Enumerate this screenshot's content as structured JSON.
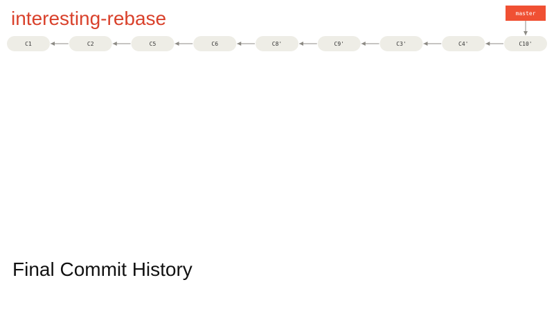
{
  "title": {
    "text": "interesting-rebase",
    "color": "#d9412b"
  },
  "caption": "Final Commit History",
  "colors": {
    "commit_fill": "#eeede6",
    "commit_text": "#333333",
    "arrow": "#8c8a84",
    "branch_fill": "#f05033",
    "branch_text": "#ffffff"
  },
  "commits": [
    {
      "label": "C1"
    },
    {
      "label": "C2"
    },
    {
      "label": "C5"
    },
    {
      "label": "C6"
    },
    {
      "label": "C8'"
    },
    {
      "label": "C9'"
    },
    {
      "label": "C3'"
    },
    {
      "label": "C4'"
    },
    {
      "label": "C10'"
    }
  ],
  "branches": [
    {
      "label": "master",
      "points_to": "C10'"
    }
  ]
}
